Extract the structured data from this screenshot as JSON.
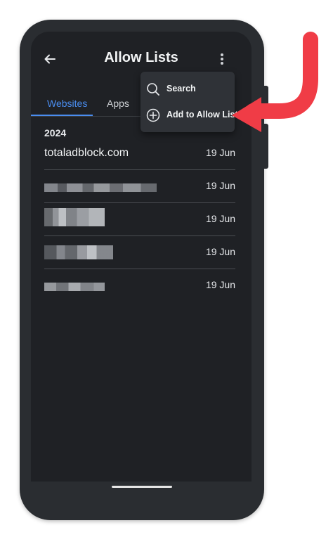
{
  "header": {
    "title": "Allow Lists",
    "back_icon": "arrow-left-icon",
    "more_icon": "more-vertical-icon"
  },
  "tabs": [
    {
      "label": "Websites",
      "active": true
    },
    {
      "label": "Apps",
      "active": false
    }
  ],
  "list": {
    "year": "2024",
    "items": [
      {
        "name": "totaladblock.com",
        "date": "19 Jun",
        "redacted": false
      },
      {
        "name": "",
        "date": "19 Jun",
        "redacted": true
      },
      {
        "name": "",
        "date": "19 Jun",
        "redacted": true
      },
      {
        "name": "",
        "date": "19 Jun",
        "redacted": true
      },
      {
        "name": "",
        "date": "19 Jun",
        "redacted": true
      }
    ]
  },
  "menu": {
    "items": [
      {
        "label": "Search",
        "icon": "search-icon"
      },
      {
        "label": "Add to Allow List",
        "icon": "add-circle-icon"
      }
    ]
  },
  "colors": {
    "accent": "#4a8df0",
    "arrow": "#f03c46",
    "screen_bg": "#1f2125",
    "menu_bg": "#2f3237"
  }
}
